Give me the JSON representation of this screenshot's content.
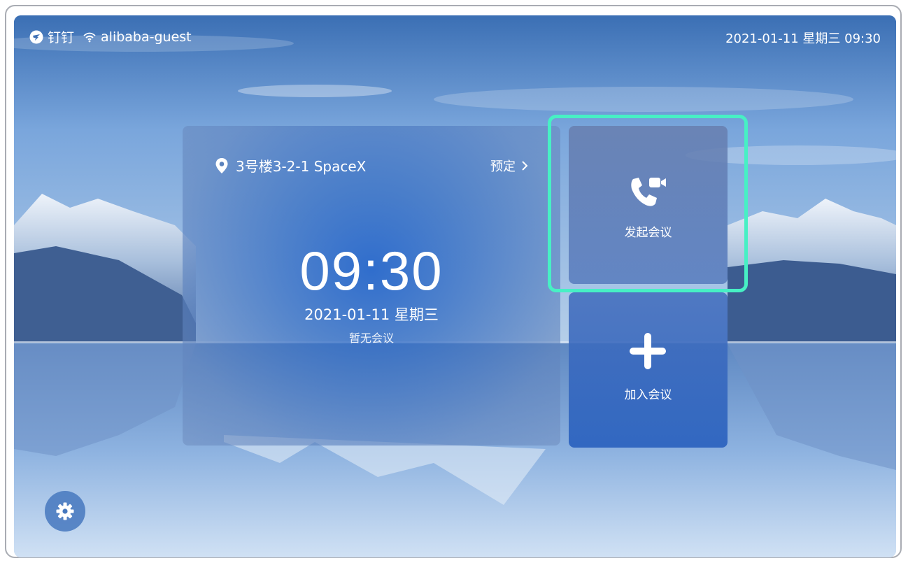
{
  "status_bar": {
    "app_name": "钉钉",
    "wifi_name": "alibaba-guest",
    "datetime": "2021-01-11 星期三 09:30"
  },
  "room_card": {
    "location": "3号楼3-2-1 SpaceX",
    "reserve_label": "预定",
    "time": "09:30",
    "date": "2021-01-11 星期三",
    "meeting_status": "暂无会议"
  },
  "actions": {
    "start_meeting_label": "发起会议",
    "join_meeting_label": "加入会议"
  },
  "icons": {
    "brand": "dingtalk-logo-icon",
    "wifi": "wifi-icon",
    "location": "location-pin-icon",
    "chevron": "chevron-right-icon",
    "start": "video-call-icon",
    "join": "plus-icon",
    "settings": "gear-icon"
  },
  "colors": {
    "highlight": "#47f0c4",
    "settings_bg": "#4678be"
  }
}
